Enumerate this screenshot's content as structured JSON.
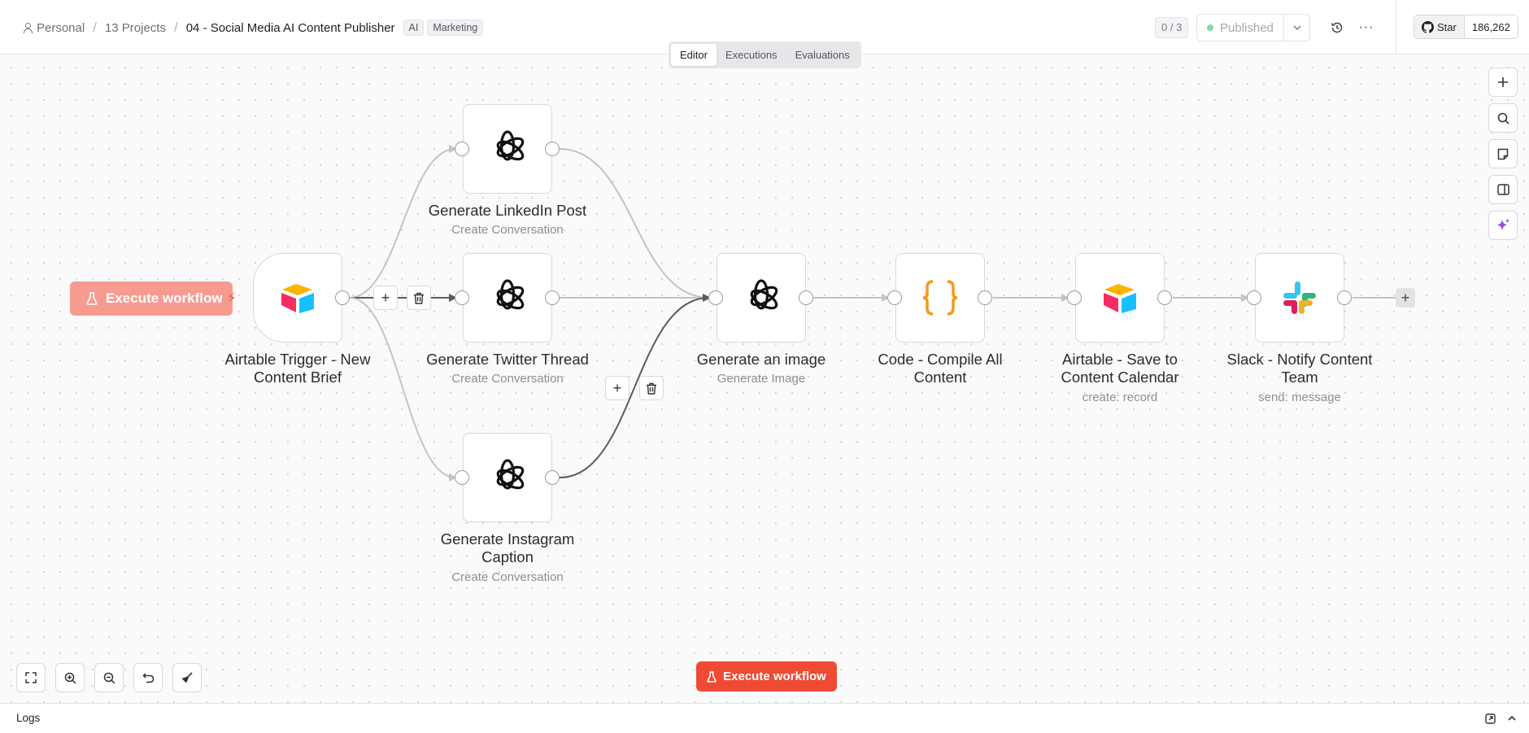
{
  "breadcrumb": {
    "workspace": "Personal",
    "projects": "13 Projects",
    "workflow": "04 - Social Media AI Content Publisher",
    "tags": [
      "AI",
      "Marketing"
    ]
  },
  "header": {
    "counter": "0 / 3",
    "published_label": "Published",
    "github_star": "Star",
    "github_count": "186,262"
  },
  "tabs": [
    "Editor",
    "Executions",
    "Evaluations"
  ],
  "nodes": {
    "airtable_trigger": {
      "title_line1": "Airtable Trigger - New",
      "title_line2": "Content Brief"
    },
    "linkedin": {
      "title": "Generate LinkedIn Post",
      "subtitle": "Create Conversation"
    },
    "twitter": {
      "title": "Generate Twitter Thread",
      "subtitle": "Create Conversation"
    },
    "instagram": {
      "title_line1": "Generate Instagram",
      "title_line2": "Caption",
      "subtitle": "Create Conversation"
    },
    "image": {
      "title": "Generate an image",
      "subtitle": "Generate Image"
    },
    "code": {
      "title_line1": "Code - Compile All",
      "title_line2": "Content"
    },
    "airtable_save": {
      "title_line1": "Airtable - Save to",
      "title_line2": "Content Calendar",
      "subtitle": "create: record"
    },
    "slack": {
      "title_line1": "Slack - Notify Content",
      "title_line2": "Team",
      "subtitle": "send: message"
    }
  },
  "execute_trigger_label": "Execute workflow",
  "execute_main_label": "Execute workflow",
  "logs_label": "Logs",
  "colors": {
    "execute": "#ef4b34",
    "execute_faded": "#f79b91",
    "published_dot": "#7fdca5",
    "code_icon": "#f29b1f",
    "ai_sparkle": "#9b51e0"
  }
}
